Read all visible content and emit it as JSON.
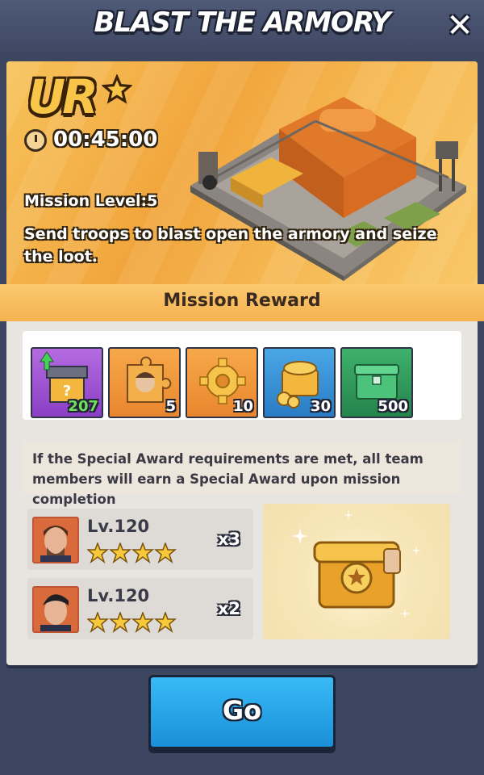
{
  "header": {
    "title": "BLAST THE ARMORY",
    "close_icon": "close-icon"
  },
  "mission": {
    "rank": "UR",
    "timer": "00:45:00",
    "level_text": "Mission Level:5",
    "description": "Send troops to blast open the armory and seize the loot."
  },
  "rewards": {
    "title": "Mission Reward",
    "items": [
      {
        "icon": "mystery-chest-icon",
        "qty": "207",
        "bg": "#9b4fd0",
        "upgrade": true
      },
      {
        "icon": "hero-puzzle-icon",
        "qty": "5",
        "bg": "#f19a3a"
      },
      {
        "icon": "gear-icon",
        "qty": "10",
        "bg": "#f19a3a"
      },
      {
        "icon": "gold-coins-icon",
        "qty": "30",
        "bg": "#3b8fd6"
      },
      {
        "icon": "green-crate-icon",
        "qty": "500",
        "bg": "#2f9b5e"
      }
    ]
  },
  "special": {
    "note": "If the Special Award requirements are met, all team members will earn a Special Award upon mission completion",
    "requirements": [
      {
        "level": "Lv.120",
        "stars": 4,
        "multiplier": "x3"
      },
      {
        "level": "Lv.120",
        "stars": 4,
        "multiplier": "x2"
      }
    ]
  },
  "go_button": {
    "label": "Go",
    "color": "#29a6ec"
  }
}
